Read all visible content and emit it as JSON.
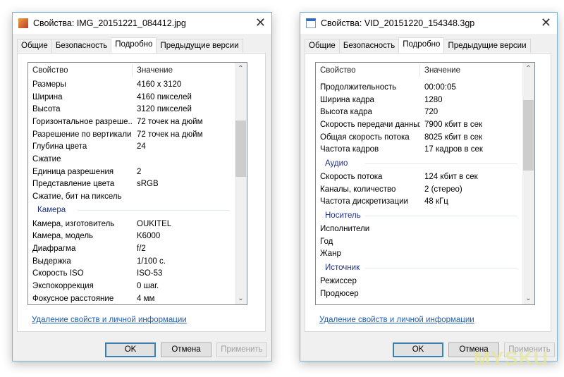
{
  "tabs": [
    "Общие",
    "Безопасность",
    "Подробно",
    "Предыдущие версии"
  ],
  "col_property": "Свойство",
  "col_value": "Значение",
  "link": "Удаление свойств и личной информации",
  "ok": "OK",
  "cancel": "Отмена",
  "apply": "Применить",
  "close": "✕",
  "w1": {
    "title": "Свойства: IMG_20151221_084412.jpg",
    "rows": [
      {
        "k": "Размеры",
        "v": "4160 x 3120"
      },
      {
        "k": "Ширина",
        "v": "4160 пикселей"
      },
      {
        "k": "Высота",
        "v": "3120 пикселей"
      },
      {
        "k": "Горизонтальное разреше...",
        "v": "72 точек на дюйм"
      },
      {
        "k": "Разрешение по вертикали",
        "v": "72 точек на дюйм"
      },
      {
        "k": "Глубина цвета",
        "v": "24"
      },
      {
        "k": "Сжатие",
        "v": ""
      },
      {
        "k": "Единица разрешения",
        "v": "2"
      },
      {
        "k": "Представление цвета",
        "v": "sRGB"
      },
      {
        "k": "Сжатие, бит на пиксель",
        "v": ""
      },
      {
        "group": "Камера"
      },
      {
        "k": "Камера, изготовитель",
        "v": "OUKITEL"
      },
      {
        "k": "Камера, модель",
        "v": "K6000"
      },
      {
        "k": "Диафрагма",
        "v": "f/2"
      },
      {
        "k": "Выдержка",
        "v": "1/100 с."
      },
      {
        "k": "Скорость ISO",
        "v": "ISO-53"
      },
      {
        "k": "Экспокоррекция",
        "v": "0 шаг."
      },
      {
        "k": "Фокусное расстояние",
        "v": "4 мм"
      }
    ]
  },
  "w2": {
    "title": "Свойства: VID_20151220_154348.3gp",
    "rows": [
      {
        "k": "Продолжительность",
        "v": "00:00:05"
      },
      {
        "k": "Ширина кадра",
        "v": "1280"
      },
      {
        "k": "Высота кадра",
        "v": "720"
      },
      {
        "k": "Скорость передачи данных",
        "v": "7900 кбит в сек"
      },
      {
        "k": "Общая скорость потока",
        "v": "8025 кбит в сек"
      },
      {
        "k": "Частота кадров",
        "v": "17 кадров в сек"
      },
      {
        "group": "Аудио"
      },
      {
        "k": "Скорость потока",
        "v": "124 кбит в сек"
      },
      {
        "k": "Каналы, количество",
        "v": "2 (стерео)"
      },
      {
        "k": "Частота дискретизации",
        "v": "48 кГц"
      },
      {
        "group": "Носитель"
      },
      {
        "k": "Исполнители",
        "v": ""
      },
      {
        "k": "Год",
        "v": ""
      },
      {
        "k": "Жанр",
        "v": ""
      },
      {
        "group": "Источник"
      },
      {
        "k": "Режиссер",
        "v": ""
      },
      {
        "k": "Продюсер",
        "v": ""
      }
    ]
  },
  "watermark": "MYSKU"
}
